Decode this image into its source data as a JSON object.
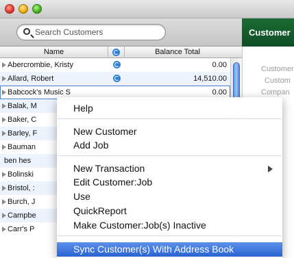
{
  "window": {
    "traffic_lights": [
      "close",
      "minimize",
      "zoom"
    ]
  },
  "search": {
    "placeholder": "Search Customers"
  },
  "right_panel": {
    "header": "Customer",
    "labels": [
      "Customer",
      "Custom",
      "Compan"
    ]
  },
  "table": {
    "columns": {
      "name": "Name",
      "sync": "sync-icon",
      "balance": "Balance Total"
    },
    "rows": [
      {
        "name": "Abercrombie, Kristy",
        "balance": "0.00",
        "synced": true,
        "arrow": true
      },
      {
        "name": "Allard, Robert",
        "balance": "14,510.00",
        "synced": true,
        "arrow": true
      },
      {
        "name": "Babcock's Music S",
        "balance": "0.00",
        "synced": false,
        "arrow": true,
        "selected": true
      },
      {
        "name": "Balak, M",
        "balance": "",
        "synced": false,
        "arrow": true
      },
      {
        "name": "Baker, C",
        "balance": "",
        "synced": false,
        "arrow": true
      },
      {
        "name": "Barley, F",
        "balance": "",
        "synced": false,
        "arrow": true
      },
      {
        "name": "Bauman",
        "balance": "",
        "synced": false,
        "arrow": true
      },
      {
        "name": "ben hes",
        "balance": "",
        "synced": false,
        "arrow": false
      },
      {
        "name": "Bolinski",
        "balance": "",
        "synced": false,
        "arrow": true
      },
      {
        "name": "Bristol, :",
        "balance": "",
        "synced": false,
        "arrow": true
      },
      {
        "name": "Burch, J",
        "balance": "",
        "synced": false,
        "arrow": true
      },
      {
        "name": "Campbe",
        "balance": "",
        "synced": false,
        "arrow": true
      },
      {
        "name": "Carr's P",
        "balance": "",
        "synced": false,
        "arrow": true
      }
    ]
  },
  "context_menu": {
    "items": [
      {
        "label": "Help"
      },
      {
        "label": "New Customer"
      },
      {
        "label": "Add Job"
      },
      {
        "label": "New Transaction",
        "submenu": true
      },
      {
        "label": "Edit Customer:Job"
      },
      {
        "label": "Use"
      },
      {
        "label": "QuickReport"
      },
      {
        "label": "Make Customer:Job(s) Inactive"
      },
      {
        "label": "Sync Customer(s) With Address Book",
        "highlighted": true
      }
    ]
  },
  "colors": {
    "accent_green": "#1b6b34",
    "selection_blue": "#2b64d1",
    "row_alt": "#edf3fd"
  }
}
